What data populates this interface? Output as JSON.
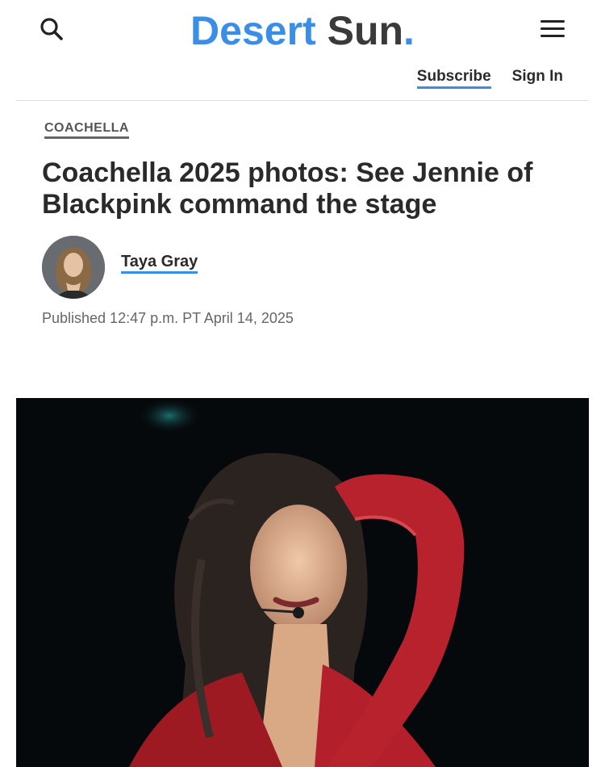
{
  "header": {
    "logo_word1": "Desert",
    "logo_word2": "Sun",
    "logo_dot": ".",
    "subscribe_label": "Subscribe",
    "signin_label": "Sign In",
    "search_icon": "search-icon",
    "menu_icon": "hamburger-menu-icon",
    "brand_color": "#3b8ee8"
  },
  "article": {
    "section": "COACHELLA",
    "headline": "Coachella 2025 photos: See Jennie of Blackpink command the stage",
    "author": "Taya Gray",
    "published": "Published 12:47 p.m. PT April 14, 2025"
  }
}
